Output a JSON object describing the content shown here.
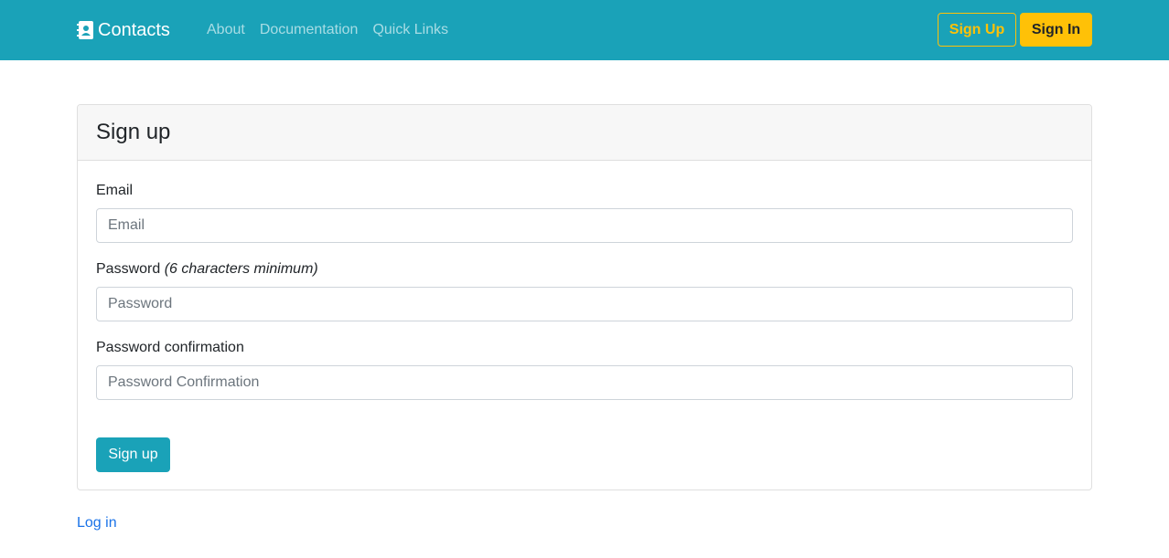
{
  "navbar": {
    "brand": "Contacts",
    "brand_icon": "contact-book-icon",
    "links": [
      "About",
      "Documentation",
      "Quick Links"
    ],
    "signup_label": "Sign Up",
    "signin_label": "Sign In"
  },
  "form": {
    "title": "Sign up",
    "email_label": "Email",
    "email_placeholder": "Email",
    "password_label": "Password",
    "password_hint": "(6 characters minimum)",
    "password_placeholder": "Password",
    "confirm_label": "Password confirmation",
    "confirm_placeholder": "Password Confirmation",
    "submit_label": "Sign up"
  },
  "footer": {
    "login_link": "Log in"
  },
  "colors": {
    "primary": "#1aa2b8",
    "warning": "#ffc107",
    "link": "#1a73e8"
  }
}
